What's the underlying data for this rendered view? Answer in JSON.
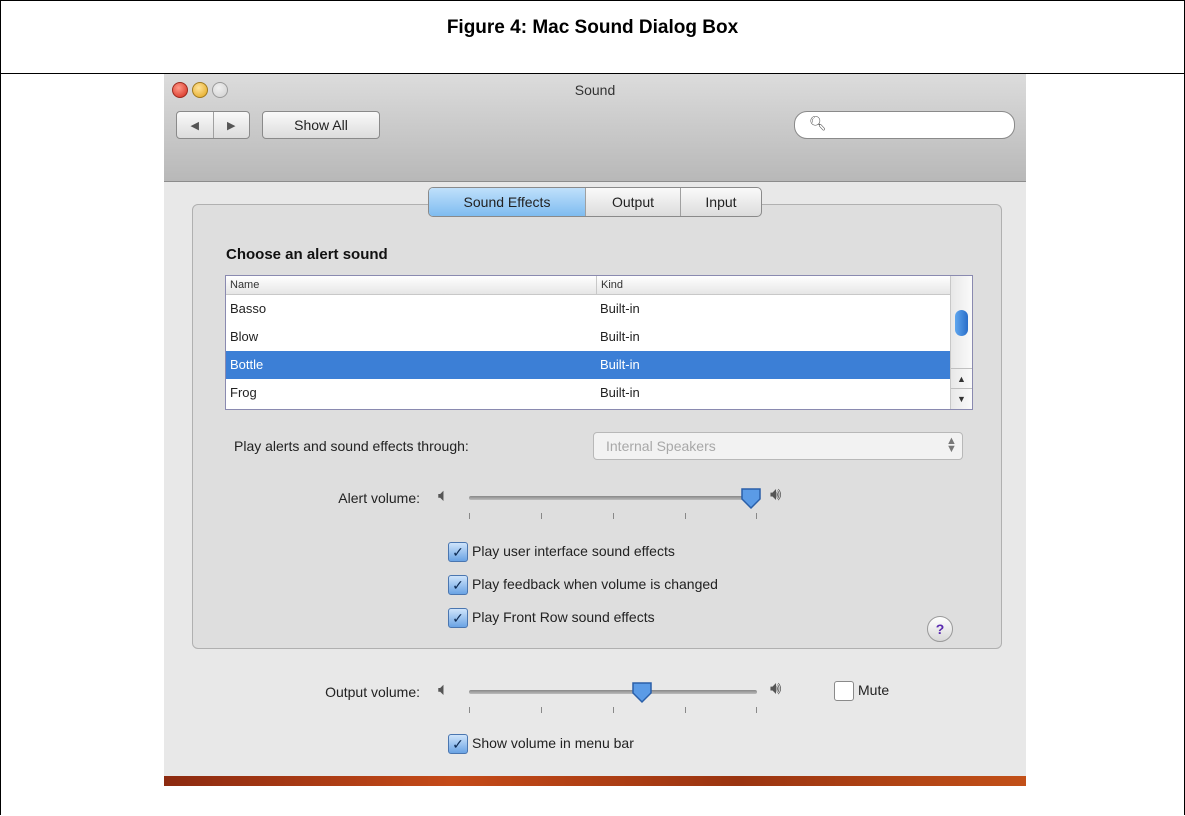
{
  "document": {
    "caption": "Figure 4: Mac Sound Dialog Box"
  },
  "window": {
    "title": "Sound",
    "nav": {
      "back_icon": "◀",
      "forward_icon": "▶"
    },
    "show_all_label": "Show All",
    "search": {
      "placeholder": "",
      "icon": "search-icon"
    }
  },
  "tabs": [
    {
      "label": "Sound Effects",
      "selected": true
    },
    {
      "label": "Output",
      "selected": false
    },
    {
      "label": "Input",
      "selected": false
    }
  ],
  "alerts": {
    "heading": "Choose an alert sound",
    "columns": {
      "name": "Name",
      "kind": "Kind"
    },
    "rows": [
      {
        "name": "Basso",
        "kind": "Built-in",
        "selected": false
      },
      {
        "name": "Blow",
        "kind": "Built-in",
        "selected": false
      },
      {
        "name": "Bottle",
        "kind": "Built-in",
        "selected": true
      },
      {
        "name": "Frog",
        "kind": "Built-in",
        "selected": false
      }
    ]
  },
  "play_through": {
    "label": "Play alerts and sound effects through:",
    "value": "Internal Speakers"
  },
  "alert_volume": {
    "label": "Alert volume:",
    "level": 0.98
  },
  "options": [
    {
      "label": "Play user interface sound effects",
      "checked": true
    },
    {
      "label": "Play feedback when volume is changed",
      "checked": true
    },
    {
      "label": "Play Front Row sound effects",
      "checked": true
    }
  ],
  "help_label": "?",
  "output_volume": {
    "label": "Output volume:",
    "level": 0.6,
    "mute_label": "Mute",
    "muted": false
  },
  "show_volume": {
    "label": "Show volume in menu bar",
    "checked": true
  },
  "colors": {
    "selection": "#3c7fd6",
    "tab_active": "#7fbcf0"
  }
}
